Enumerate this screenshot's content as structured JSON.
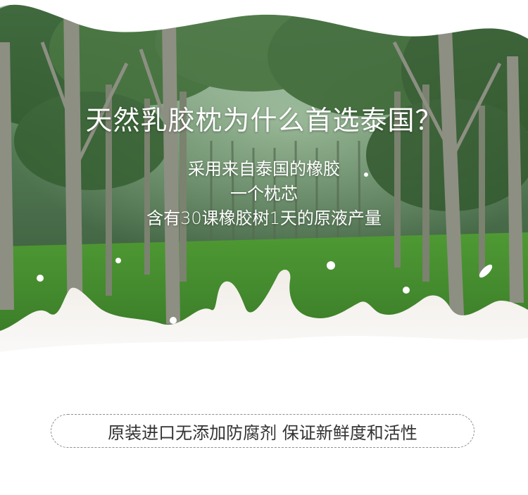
{
  "hero": {
    "headline": "天然乳胶枕为什么首选泰国？",
    "sub_lines": [
      "采用来自泰国的橡胶",
      "一个枕芯",
      "含有30课橡胶树1天的原液产量"
    ]
  },
  "banner": {
    "text": "原装进口无添加防腐剂 保证新鲜度和活性"
  },
  "colors": {
    "forest_dark": "#1f3b22",
    "forest_mid": "#3f6a34",
    "grass": "#4f9a34",
    "milk": "#ffffff",
    "text_dark": "#333333",
    "border_gray": "#8e8e8e"
  }
}
